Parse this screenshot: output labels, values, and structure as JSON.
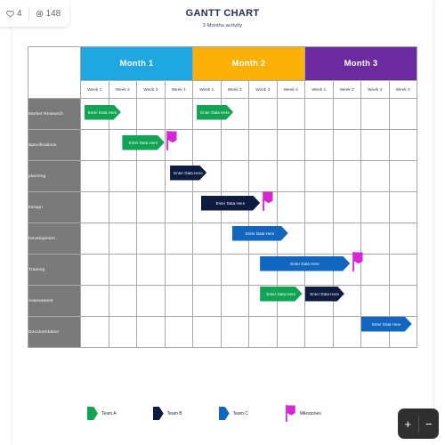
{
  "stats": {
    "likes": "4",
    "views": "148",
    "like_icon": "heart-icon",
    "view_icon": "eye-icon"
  },
  "header": {
    "title": "GANTT CHART",
    "subtitle": "3 Months activity"
  },
  "colors": {
    "month1": "#1EA7E1",
    "month2": "#FAB005",
    "month3": "#6B2B9E",
    "team_a": "#13A355",
    "team_b": "#0D1B3E",
    "team_c": "#1366BF",
    "milestone": "#D626D6",
    "row_label_bg": "#7A7A7A",
    "grid_line": "#A8A8A8"
  },
  "grid": {
    "months": [
      {
        "label": "Month 1",
        "color": "#1EA7E1"
      },
      {
        "label": "Month 2",
        "color": "#FAB005"
      },
      {
        "label": "Month 3",
        "color": "#6B2B9E"
      }
    ],
    "weeks": [
      "Week 1",
      "Week 2",
      "Week 3",
      "Week 4",
      "Week 1",
      "Week 2",
      "Week 3",
      "Week 4",
      "Week 1",
      "Week 2",
      "Week 3",
      "Week 4"
    ],
    "rows": [
      "Market Research",
      "Specifications",
      "planning",
      "Design",
      "Development",
      "Training",
      "Assessment",
      "Documentation"
    ]
  },
  "bar_label": "Enter Data Here",
  "chart_data": {
    "type": "bar",
    "title": "GANTT CHART",
    "subtitle": "3 Months activity",
    "xlabel": "",
    "ylabel": "",
    "categories": [
      "Market Research",
      "Specifications",
      "planning",
      "Design",
      "Development",
      "Training",
      "Assessment",
      "Documentation"
    ],
    "x_ticks": [
      "Week 1",
      "Week 2",
      "Week 3",
      "Week 4",
      "Week 1",
      "Week 2",
      "Week 3",
      "Week 4",
      "Week 1",
      "Week 2",
      "Week 3",
      "Week 4"
    ],
    "x_groups": [
      "Month 1",
      "Month 2",
      "Month 3"
    ],
    "xlim": [
      0,
      12
    ],
    "grid": true,
    "legend_position": "bottom",
    "legend": [
      {
        "name": "Team A",
        "color": "#13A355",
        "shape": "arrow"
      },
      {
        "name": "Team B",
        "color": "#0D1B3E",
        "shape": "arrow"
      },
      {
        "name": "Team C",
        "color": "#1366BF",
        "shape": "arrow"
      },
      {
        "name": "Milestones",
        "color": "#D626D6",
        "shape": "flag"
      }
    ],
    "tasks": [
      {
        "row": 0,
        "row_label": "Market Research",
        "team": "Team A",
        "color": "#13A355",
        "start_week": 0.15,
        "end_week": 1.45,
        "label": "Enter Data Here"
      },
      {
        "row": 0,
        "row_label": "Market Research",
        "team": "Team A",
        "color": "#13A355",
        "start_week": 4.15,
        "end_week": 5.45,
        "label": "Enter Data Here"
      },
      {
        "row": 1,
        "row_label": "Specifications",
        "team": "Team A",
        "color": "#13A355",
        "start_week": 1.5,
        "end_week": 3.0,
        "label": "Enter Data Here"
      },
      {
        "row": 2,
        "row_label": "planning",
        "team": "Team B",
        "color": "#0D1B3E",
        "start_week": 3.2,
        "end_week": 4.5,
        "label": "Enter Data Here"
      },
      {
        "row": 3,
        "row_label": "Design",
        "team": "Team B",
        "color": "#0D1B3E",
        "start_week": 4.3,
        "end_week": 6.4,
        "label": "Enter Data Here"
      },
      {
        "row": 4,
        "row_label": "Development",
        "team": "Team C",
        "color": "#1366BF",
        "start_week": 5.4,
        "end_week": 7.4,
        "label": "Enter Data Here"
      },
      {
        "row": 5,
        "row_label": "Training",
        "team": "Team C",
        "color": "#1366BF",
        "start_week": 6.4,
        "end_week": 9.6,
        "label": "Enter Data Here"
      },
      {
        "row": 6,
        "row_label": "Assessment",
        "team": "Team A",
        "color": "#13A355",
        "start_week": 6.4,
        "end_week": 7.9,
        "label": "Enter Data Here"
      },
      {
        "row": 6,
        "row_label": "Assessment",
        "team": "Team B",
        "color": "#0D1B3E",
        "start_week": 8.0,
        "end_week": 9.4,
        "label": "Enter Data Here"
      },
      {
        "row": 7,
        "row_label": "Documentation",
        "team": "Team C",
        "color": "#1366BF",
        "start_week": 10.0,
        "end_week": 11.8,
        "label": "Enter Data Here"
      }
    ],
    "milestones": [
      {
        "row": 1,
        "row_label": "Specifications",
        "week": 3.05,
        "color": "#D626D6"
      },
      {
        "row": 3,
        "row_label": "Design",
        "week": 6.45,
        "color": "#D626D6"
      },
      {
        "row": 5,
        "row_label": "Training",
        "week": 9.65,
        "color": "#D626D6"
      }
    ]
  },
  "zoom": {
    "in_label": "+",
    "out_label": "−"
  }
}
